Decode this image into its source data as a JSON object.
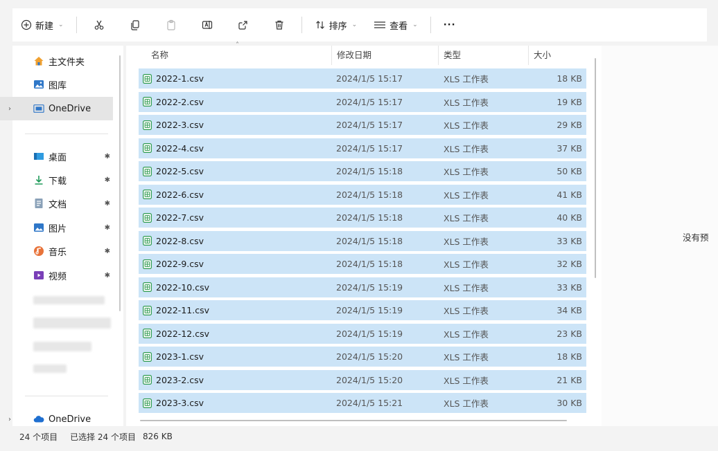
{
  "toolbar": {
    "new_label": "新建",
    "sort_label": "排序",
    "view_label": "查看",
    "more_label": "···"
  },
  "sidebar": {
    "pinned_top": [
      {
        "label": "主文件夹",
        "icon": "home-icon"
      },
      {
        "label": "图库",
        "icon": "gallery-icon"
      },
      {
        "label": "OneDrive",
        "icon": "onedrive-folder-icon"
      }
    ],
    "quick_access": [
      {
        "label": "桌面",
        "icon": "desktop-icon"
      },
      {
        "label": "下载",
        "icon": "download-icon"
      },
      {
        "label": "文档",
        "icon": "document-icon"
      },
      {
        "label": "图片",
        "icon": "pictures-icon"
      },
      {
        "label": "音乐",
        "icon": "music-icon"
      },
      {
        "label": "视频",
        "icon": "video-icon"
      }
    ],
    "bottom_item": {
      "label": "OneDrive",
      "icon": "cloud-icon"
    },
    "pin_glyph": "✱"
  },
  "columns": {
    "name": "名称",
    "modified": "修改日期",
    "type": "类型",
    "size": "大小"
  },
  "files": [
    {
      "name": "2022-1.csv",
      "modified": "2024/1/5 15:17",
      "type": "XLS 工作表",
      "size": "18 KB"
    },
    {
      "name": "2022-2.csv",
      "modified": "2024/1/5 15:17",
      "type": "XLS 工作表",
      "size": "19 KB"
    },
    {
      "name": "2022-3.csv",
      "modified": "2024/1/5 15:17",
      "type": "XLS 工作表",
      "size": "29 KB"
    },
    {
      "name": "2022-4.csv",
      "modified": "2024/1/5 15:17",
      "type": "XLS 工作表",
      "size": "37 KB"
    },
    {
      "name": "2022-5.csv",
      "modified": "2024/1/5 15:18",
      "type": "XLS 工作表",
      "size": "50 KB"
    },
    {
      "name": "2022-6.csv",
      "modified": "2024/1/5 15:18",
      "type": "XLS 工作表",
      "size": "41 KB"
    },
    {
      "name": "2022-7.csv",
      "modified": "2024/1/5 15:18",
      "type": "XLS 工作表",
      "size": "40 KB"
    },
    {
      "name": "2022-8.csv",
      "modified": "2024/1/5 15:18",
      "type": "XLS 工作表",
      "size": "33 KB"
    },
    {
      "name": "2022-9.csv",
      "modified": "2024/1/5 15:18",
      "type": "XLS 工作表",
      "size": "32 KB"
    },
    {
      "name": "2022-10.csv",
      "modified": "2024/1/5 15:19",
      "type": "XLS 工作表",
      "size": "33 KB"
    },
    {
      "name": "2022-11.csv",
      "modified": "2024/1/5 15:19",
      "type": "XLS 工作表",
      "size": "34 KB"
    },
    {
      "name": "2022-12.csv",
      "modified": "2024/1/5 15:19",
      "type": "XLS 工作表",
      "size": "23 KB"
    },
    {
      "name": "2023-1.csv",
      "modified": "2024/1/5 15:20",
      "type": "XLS 工作表",
      "size": "18 KB"
    },
    {
      "name": "2023-2.csv",
      "modified": "2024/1/5 15:20",
      "type": "XLS 工作表",
      "size": "21 KB"
    },
    {
      "name": "2023-3.csv",
      "modified": "2024/1/5 15:21",
      "type": "XLS 工作表",
      "size": "30 KB"
    }
  ],
  "preview": {
    "text": "没有预"
  },
  "status": {
    "item_count": "24 个项目",
    "selected": "已选择 24 个项目",
    "selected_size": "826 KB"
  },
  "colors": {
    "selection": "#cce4f7",
    "accent": "#0067c0",
    "csv_icon": "#2e9a4f"
  }
}
